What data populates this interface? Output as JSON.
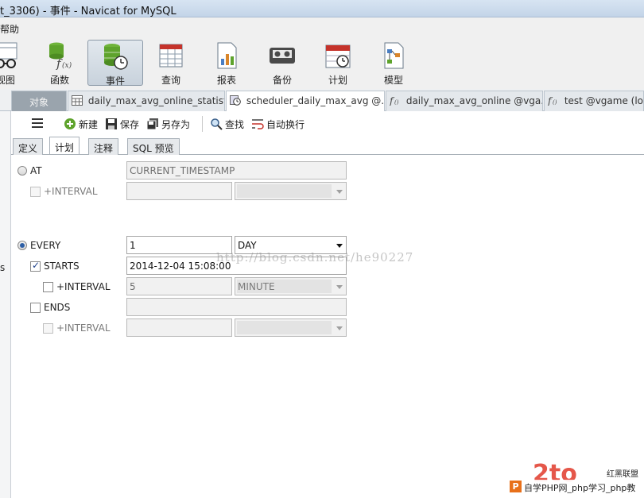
{
  "window": {
    "title": "t_3306) - 事件 - Navicat for MySQL"
  },
  "menu": {
    "help": "帮助"
  },
  "toolbar": {
    "items": [
      {
        "label": "视图",
        "icon": "view-icon"
      },
      {
        "label": "函数",
        "icon": "function-icon"
      },
      {
        "label": "事件",
        "icon": "event-icon",
        "active": true
      },
      {
        "label": "查询",
        "icon": "query-icon"
      },
      {
        "label": "报表",
        "icon": "report-icon"
      },
      {
        "label": "备份",
        "icon": "backup-icon"
      },
      {
        "label": "计划",
        "icon": "schedule-icon"
      },
      {
        "label": "模型",
        "icon": "model-icon"
      }
    ]
  },
  "tabs": [
    {
      "label": "对象"
    },
    {
      "label": "daily_max_avg_online_statist...",
      "icon": "table-icon"
    },
    {
      "label": "scheduler_daily_max_avg @...",
      "icon": "event-icon",
      "active": true
    },
    {
      "label": "daily_max_avg_online @vga...",
      "icon": "procedure-icon"
    },
    {
      "label": "test @vgame (loc",
      "icon": "procedure-icon"
    }
  ],
  "left_panel": {
    "letter": "s"
  },
  "editor_toolbar": {
    "new": "新建",
    "save": "保存",
    "save_as": "另存为",
    "find": "查找",
    "word_wrap": "自动换行"
  },
  "subtabs": [
    {
      "label": "定义"
    },
    {
      "label": "计划",
      "active": true
    },
    {
      "label": "注释"
    },
    {
      "label": "SQL 预览"
    }
  ],
  "form": {
    "at": {
      "label": "AT",
      "value": "CURRENT_TIMESTAMP",
      "selected": false
    },
    "at_interval": {
      "label": "+INTERVAL",
      "value": "",
      "unit": ""
    },
    "every": {
      "label": "EVERY",
      "value": "1",
      "unit": "DAY",
      "selected": true
    },
    "starts": {
      "label": "STARTS",
      "value": "2014-12-04 15:08:00",
      "checked": true
    },
    "starts_interval": {
      "label": "+INTERVAL",
      "value": "5",
      "unit": "MINUTE"
    },
    "ends": {
      "label": "ENDS",
      "value": "",
      "checked": false
    },
    "ends_interval": {
      "label": "+INTERVAL",
      "value": "",
      "unit": ""
    }
  },
  "watermarks": {
    "url": "http://blog.csdn.net/he90227",
    "brand": "红黑联盟",
    "site": "自学PHP网_php学习_php教"
  },
  "colors": {
    "accent": "#2d5fa6",
    "objects_tab": "#9aa4ad",
    "toolbar_bg": "#f0f0f0"
  }
}
